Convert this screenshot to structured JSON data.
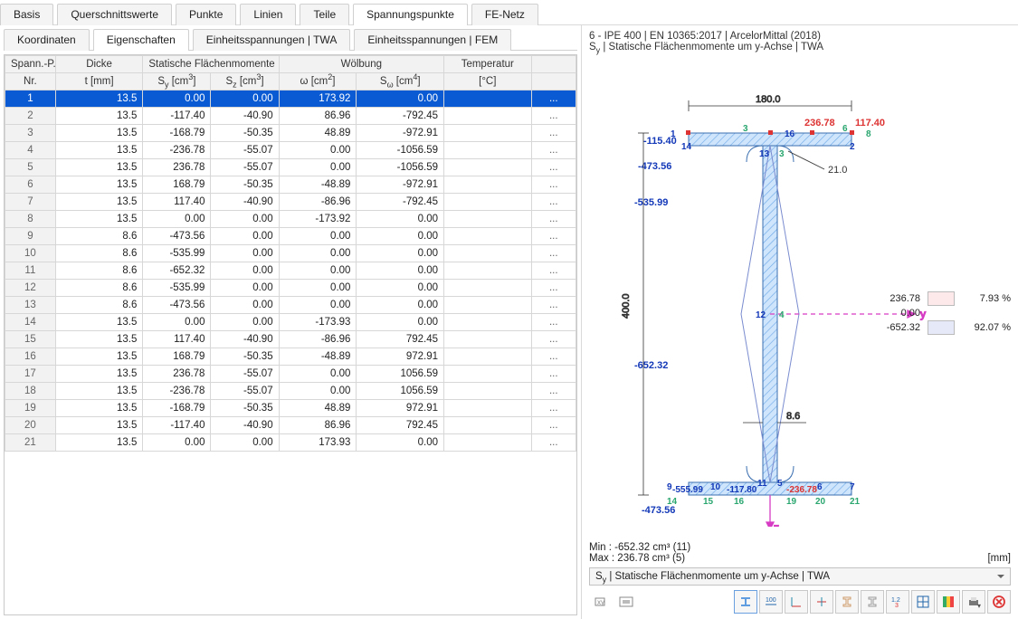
{
  "main_tabs": [
    "Basis",
    "Querschnittswerte",
    "Punkte",
    "Linien",
    "Teile",
    "Spannungspunkte",
    "FE-Netz"
  ],
  "main_tab_active": 5,
  "sub_tabs": [
    "Koordinaten",
    "Eigenschaften",
    "Einheitsspannungen | TWA",
    "Einheitsspannungen | FEM"
  ],
  "sub_tab_active": 1,
  "columns": {
    "group": [
      "Spann.-P.",
      "Dicke",
      "Statische Flächenmomente",
      "Wölbung",
      "",
      "Temperatur",
      ""
    ],
    "nr": "Nr.",
    "t": "t [mm]",
    "sy": "S<sub>y</sub> [cm<sup>3</sup>]",
    "sz": "S<sub>z</sub> [cm<sup>3</sup>]",
    "w": "ω [cm<sup>2</sup>]",
    "sw": "S<sub>ω</sub> [cm<sup>4</sup>]",
    "temp": "[°C]"
  },
  "rows": [
    {
      "nr": 1,
      "t": "13.5",
      "sy": "0.00",
      "sz": "0.00",
      "w": "173.92",
      "sw": "0.00",
      "temp": "",
      "sel": true
    },
    {
      "nr": 2,
      "t": "13.5",
      "sy": "-117.40",
      "sz": "-40.90",
      "w": "86.96",
      "sw": "-792.45",
      "temp": ""
    },
    {
      "nr": 3,
      "t": "13.5",
      "sy": "-168.79",
      "sz": "-50.35",
      "w": "48.89",
      "sw": "-972.91",
      "temp": ""
    },
    {
      "nr": 4,
      "t": "13.5",
      "sy": "-236.78",
      "sz": "-55.07",
      "w": "0.00",
      "sw": "-1056.59",
      "temp": ""
    },
    {
      "nr": 5,
      "t": "13.5",
      "sy": "236.78",
      "sz": "-55.07",
      "w": "0.00",
      "sw": "-1056.59",
      "temp": ""
    },
    {
      "nr": 6,
      "t": "13.5",
      "sy": "168.79",
      "sz": "-50.35",
      "w": "-48.89",
      "sw": "-972.91",
      "temp": ""
    },
    {
      "nr": 7,
      "t": "13.5",
      "sy": "117.40",
      "sz": "-40.90",
      "w": "-86.96",
      "sw": "-792.45",
      "temp": ""
    },
    {
      "nr": 8,
      "t": "13.5",
      "sy": "0.00",
      "sz": "0.00",
      "w": "-173.92",
      "sw": "0.00",
      "temp": ""
    },
    {
      "nr": 9,
      "t": "8.6",
      "sy": "-473.56",
      "sz": "0.00",
      "w": "0.00",
      "sw": "0.00",
      "temp": ""
    },
    {
      "nr": 10,
      "t": "8.6",
      "sy": "-535.99",
      "sz": "0.00",
      "w": "0.00",
      "sw": "0.00",
      "temp": ""
    },
    {
      "nr": 11,
      "t": "8.6",
      "sy": "-652.32",
      "sz": "0.00",
      "w": "0.00",
      "sw": "0.00",
      "temp": ""
    },
    {
      "nr": 12,
      "t": "8.6",
      "sy": "-535.99",
      "sz": "0.00",
      "w": "0.00",
      "sw": "0.00",
      "temp": ""
    },
    {
      "nr": 13,
      "t": "8.6",
      "sy": "-473.56",
      "sz": "0.00",
      "w": "0.00",
      "sw": "0.00",
      "temp": ""
    },
    {
      "nr": 14,
      "t": "13.5",
      "sy": "0.00",
      "sz": "0.00",
      "w": "-173.93",
      "sw": "0.00",
      "temp": ""
    },
    {
      "nr": 15,
      "t": "13.5",
      "sy": "117.40",
      "sz": "-40.90",
      "w": "-86.96",
      "sw": "792.45",
      "temp": ""
    },
    {
      "nr": 16,
      "t": "13.5",
      "sy": "168.79",
      "sz": "-50.35",
      "w": "-48.89",
      "sw": "972.91",
      "temp": ""
    },
    {
      "nr": 17,
      "t": "13.5",
      "sy": "236.78",
      "sz": "-55.07",
      "w": "0.00",
      "sw": "1056.59",
      "temp": ""
    },
    {
      "nr": 18,
      "t": "13.5",
      "sy": "-236.78",
      "sz": "-55.07",
      "w": "0.00",
      "sw": "1056.59",
      "temp": ""
    },
    {
      "nr": 19,
      "t": "13.5",
      "sy": "-168.79",
      "sz": "-50.35",
      "w": "48.89",
      "sw": "972.91",
      "temp": ""
    },
    {
      "nr": 20,
      "t": "13.5",
      "sy": "-117.40",
      "sz": "-40.90",
      "w": "86.96",
      "sw": "792.45",
      "temp": ""
    },
    {
      "nr": 21,
      "t": "13.5",
      "sy": "0.00",
      "sz": "0.00",
      "w": "173.93",
      "sw": "0.00",
      "temp": ""
    }
  ],
  "right": {
    "title": "6 - IPE 400 | EN 10365:2017 | ArcelorMittal (2018)",
    "sub": "S<sub>y</sub> | Statische Flächenmomente um y-Achse | TWA",
    "dim_w": "180.0",
    "dim_h": "400.0",
    "dim_web": "8.6",
    "dim_r": "21.0",
    "legend": [
      {
        "val": "236.78",
        "pct": "7.93 %",
        "color": "#fde9ea"
      },
      {
        "val": "0.00",
        "pct": "",
        "color": ""
      },
      {
        "val": "-652.32",
        "pct": "92.07 %",
        "color": "#e6e9f7"
      }
    ],
    "min": "Min : -652.32 cm³ (11)",
    "max": "Max :  236.78 cm³ (5)",
    "unit": "[mm]",
    "dropdown": "S<sub>y</sub> | Statische Flächenmomente um y-Achse | TWA",
    "annot": {
      "p1_115_40": "-115.40",
      "p236_78": "236.78",
      "p117_40": "117.40",
      "m473_56": "-473.56",
      "m535_99": "-535.99",
      "m652_32": "-652.32",
      "m555_99": "-555.99",
      "m117_80": "-117.80",
      "m236_74": "-236.78"
    }
  },
  "toolbar_icons": [
    "values",
    "dim",
    "axes-local",
    "axes",
    "section",
    "section2",
    "numbers",
    "grid",
    "colors",
    "print",
    "menu",
    "close"
  ]
}
